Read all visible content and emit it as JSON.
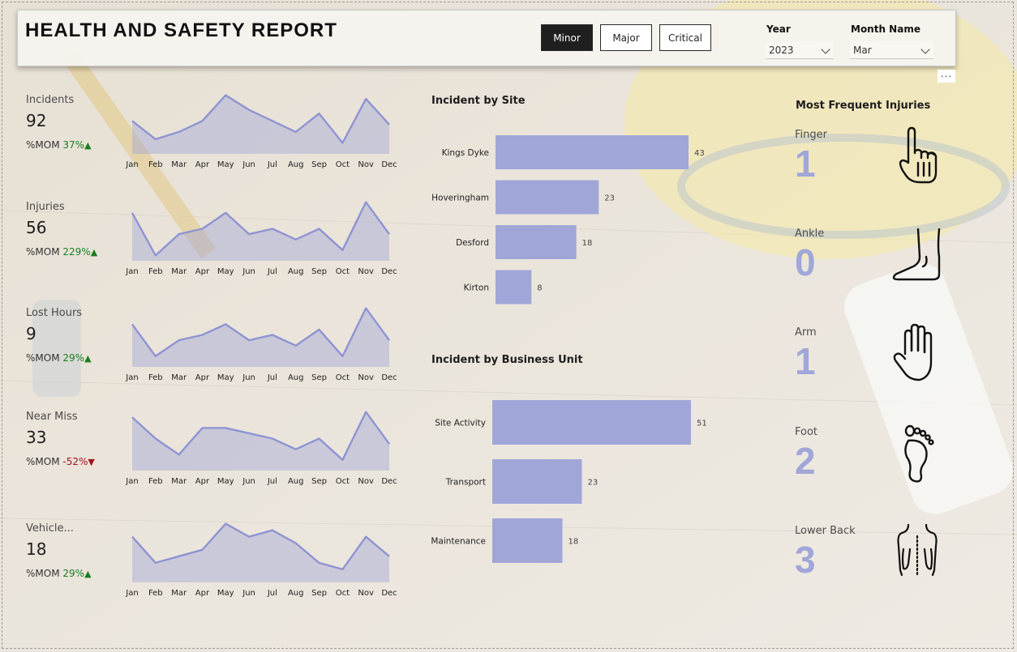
{
  "header": {
    "title": "HEALTH AND SAFETY REPORT",
    "severity": [
      {
        "label": "Minor",
        "active": true
      },
      {
        "label": "Major",
        "active": false
      },
      {
        "label": "Critical",
        "active": false
      }
    ],
    "year_label": "Year",
    "year_value": "2023",
    "month_label": "Month Name",
    "month_value": "Mar",
    "more_options": "..."
  },
  "colors": {
    "accent": "#a1a6d8",
    "line": "#8e94d2",
    "up": "#1b7c20",
    "down": "#a4111d"
  },
  "kpis": [
    {
      "label": "Incidents",
      "value": "92",
      "mom_label": "%MOM",
      "mom_value": "37%",
      "mom_dir": "up"
    },
    {
      "label": "Injuries",
      "value": "56",
      "mom_label": "%MOM",
      "mom_value": "229%",
      "mom_dir": "up"
    },
    {
      "label": "Lost Hours",
      "value": "9",
      "mom_label": "%MOM",
      "mom_value": "29%",
      "mom_dir": "up"
    },
    {
      "label": "Near Miss",
      "value": "33",
      "mom_label": "%MOM",
      "mom_value": "-52%",
      "mom_dir": "down"
    },
    {
      "label": "Vehicle...",
      "value": "18",
      "mom_label": "%MOM",
      "mom_value": "29%",
      "mom_dir": "up"
    }
  ],
  "chart_data": [
    {
      "type": "area",
      "x": [
        "Jan",
        "Feb",
        "Mar",
        "Apr",
        "May",
        "Jun",
        "Jul",
        "Aug",
        "Sep",
        "Oct",
        "Nov",
        "Dec"
      ],
      "values": [
        9,
        4,
        6,
        9,
        16,
        12,
        9,
        6,
        11,
        3,
        15,
        8
      ]
    },
    {
      "type": "area",
      "x": [
        "Jan",
        "Feb",
        "Mar",
        "Apr",
        "May",
        "Jun",
        "Jul",
        "Aug",
        "Sep",
        "Oct",
        "Nov",
        "Dec"
      ],
      "values": [
        9,
        1,
        5,
        6,
        9,
        5,
        6,
        4,
        6,
        2,
        11,
        5
      ]
    },
    {
      "type": "area",
      "x": [
        "Jan",
        "Feb",
        "Mar",
        "Apr",
        "May",
        "Jun",
        "Jul",
        "Aug",
        "Sep",
        "Oct",
        "Nov",
        "Dec"
      ],
      "values": [
        8,
        2,
        5,
        6,
        8,
        5,
        6,
        4,
        7,
        2,
        11,
        5
      ]
    },
    {
      "type": "area",
      "x": [
        "Jan",
        "Feb",
        "Mar",
        "Apr",
        "May",
        "Jun",
        "Jul",
        "Aug",
        "Sep",
        "Oct",
        "Nov",
        "Dec"
      ],
      "values": [
        10,
        6,
        3,
        8,
        8,
        7,
        6,
        4,
        6,
        2,
        11,
        5
      ]
    },
    {
      "type": "area",
      "x": [
        "Jan",
        "Feb",
        "Mar",
        "Apr",
        "May",
        "Jun",
        "Jul",
        "Aug",
        "Sep",
        "Oct",
        "Nov",
        "Dec"
      ],
      "values": [
        7,
        3,
        4,
        5,
        9,
        7,
        8,
        6,
        3,
        2,
        7,
        4
      ]
    },
    {
      "type": "bar",
      "orientation": "horizontal",
      "title": "Incident by Site",
      "categories": [
        "Kings Dyke",
        "Hoveringham",
        "Desford",
        "Kirton"
      ],
      "values": [
        43,
        23,
        18,
        8
      ]
    },
    {
      "type": "bar",
      "orientation": "horizontal",
      "title": "Incident by Business Unit",
      "categories": [
        "Site Activity",
        "Transport",
        "Maintenance"
      ],
      "values": [
        51,
        23,
        18
      ]
    }
  ],
  "injuries": {
    "title": "Most Frequent Injuries",
    "items": [
      {
        "name": "Finger",
        "count": "1",
        "icon": "finger-icon"
      },
      {
        "name": "Ankle",
        "count": "0",
        "icon": "ankle-icon"
      },
      {
        "name": "Arm",
        "count": "1",
        "icon": "hand-icon"
      },
      {
        "name": "Foot",
        "count": "2",
        "icon": "foot-icon"
      },
      {
        "name": "Lower Back",
        "count": "3",
        "icon": "lower-back-icon"
      }
    ]
  }
}
